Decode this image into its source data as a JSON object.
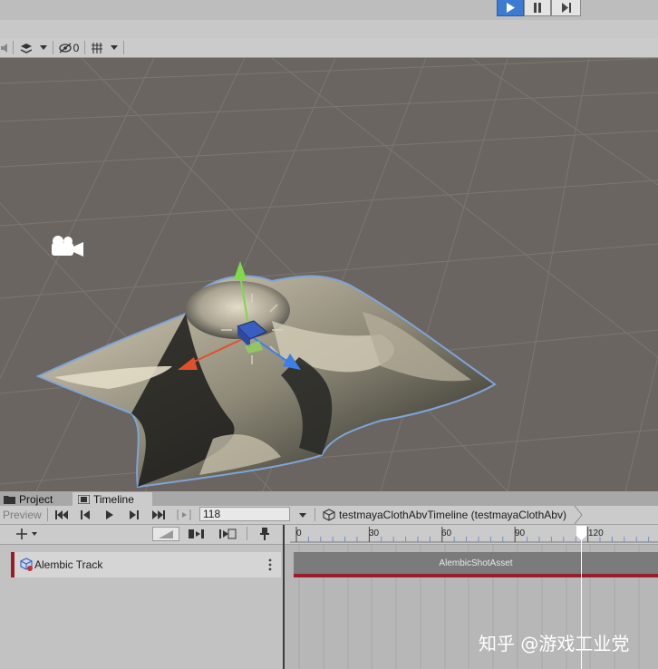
{
  "playbar": {
    "play_icon": "play-icon",
    "pause_icon": "pause-icon",
    "step_icon": "step-forward-icon"
  },
  "scene_toolbar": {
    "hidden_count": "0"
  },
  "tabs": [
    {
      "label": "Project"
    },
    {
      "label": "Timeline"
    }
  ],
  "timeline": {
    "preview_label": "Preview",
    "frame_value": "118",
    "asset_label": "testmayaClothAbvTimeline (testmayaClothAbv)",
    "ruler_labels": [
      "0",
      "30",
      "60",
      "90",
      "120"
    ],
    "playhead_frame": 118,
    "track_name": "Alembic Track",
    "clip_label": "AlembicShotAsset",
    "track_color": "#9b1c2a",
    "playhead_color": "#ffffff"
  },
  "watermark": "知乎 @游戏工业党",
  "colors": {
    "accent": "#3c7bd3",
    "scene_bg": "#6a6560"
  }
}
